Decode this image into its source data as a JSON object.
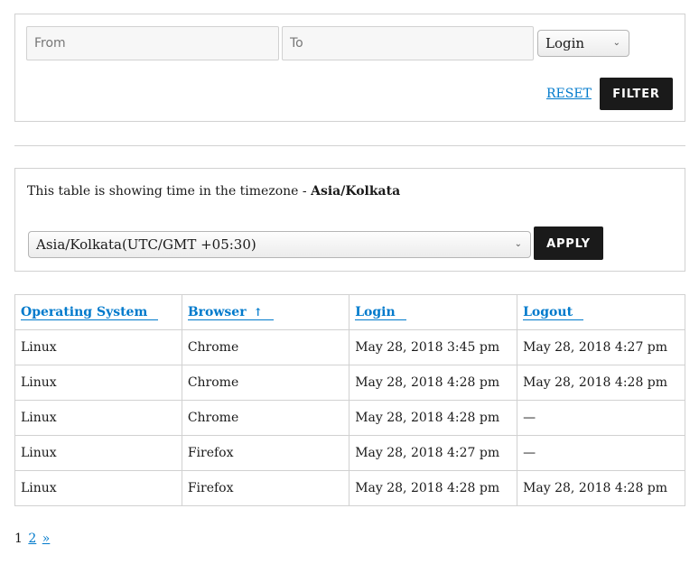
{
  "filter": {
    "from_placeholder": "From",
    "to_placeholder": "To",
    "type_select": {
      "selected": "Login"
    },
    "reset_label": "RESET",
    "filter_label": "FILTER"
  },
  "timezone": {
    "message_prefix": "This table is showing time in the timezone - ",
    "current_zone": "Asia/Kolkata",
    "select_value": "Asia/Kolkata(UTC/GMT +05:30)",
    "apply_label": "APPLY"
  },
  "table": {
    "columns": [
      {
        "label": "Operating System",
        "sort_icon": ""
      },
      {
        "label": "Browser",
        "sort_icon": "↑"
      },
      {
        "label": "Login",
        "sort_icon": ""
      },
      {
        "label": "Logout",
        "sort_icon": ""
      }
    ],
    "rows": [
      {
        "os": "Linux",
        "browser": "Chrome",
        "login": "May 28, 2018 3:45 pm",
        "logout": "May 28, 2018 4:27 pm"
      },
      {
        "os": "Linux",
        "browser": "Chrome",
        "login": "May 28, 2018 4:28 pm",
        "logout": "May 28, 2018 4:28 pm"
      },
      {
        "os": "Linux",
        "browser": "Chrome",
        "login": "May 28, 2018 4:28 pm",
        "logout": "—"
      },
      {
        "os": "Linux",
        "browser": "Firefox",
        "login": "May 28, 2018 4:27 pm",
        "logout": "—"
      },
      {
        "os": "Linux",
        "browser": "Firefox",
        "login": "May 28, 2018 4:28 pm",
        "logout": "May 28, 2018 4:28 pm"
      }
    ]
  },
  "pagination": {
    "current": "1",
    "next_page": "2",
    "next_label": "»"
  },
  "icons": {
    "chevron": "⌄"
  },
  "colors": {
    "link": "#007acc",
    "button_bg": "#1a1a1a",
    "border": "#d1d1d1"
  }
}
